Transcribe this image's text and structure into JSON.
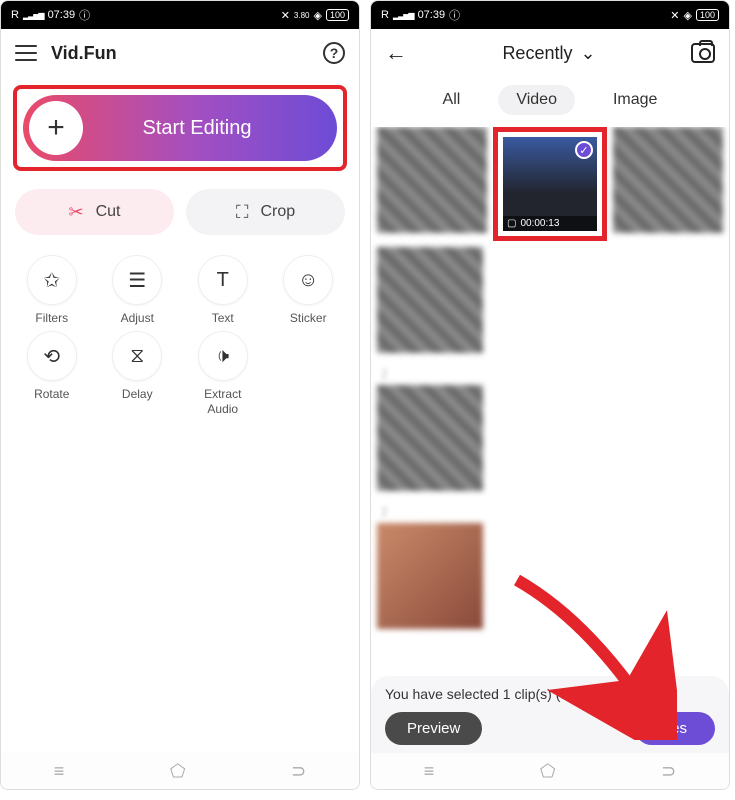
{
  "status": {
    "time": "07:39",
    "net_label": "R",
    "battery": "100"
  },
  "screen1": {
    "app_title": "Vid.Fun",
    "start": {
      "label": "Start Editing",
      "plus": "+"
    },
    "pills": {
      "cut": "Cut",
      "crop": "Crop"
    },
    "tools": [
      {
        "icon": "star",
        "label": "Filters"
      },
      {
        "icon": "adjust",
        "label": "Adjust"
      },
      {
        "icon": "text",
        "label": "Text"
      },
      {
        "icon": "smile",
        "label": "Sticker"
      },
      {
        "icon": "rotate",
        "label": "Rotate"
      },
      {
        "icon": "hourglass",
        "label": "Delay"
      },
      {
        "icon": "audio",
        "label": "Extract\nAudio"
      }
    ]
  },
  "screen2": {
    "dropdown": "Recently",
    "tabs": {
      "all": "All",
      "video": "Video",
      "image": "Image"
    },
    "selected_duration": "00:00:13",
    "footer_text": "You have selected 1 clip(s) (u                   ).",
    "preview": "Preview",
    "yes": "Yes"
  }
}
